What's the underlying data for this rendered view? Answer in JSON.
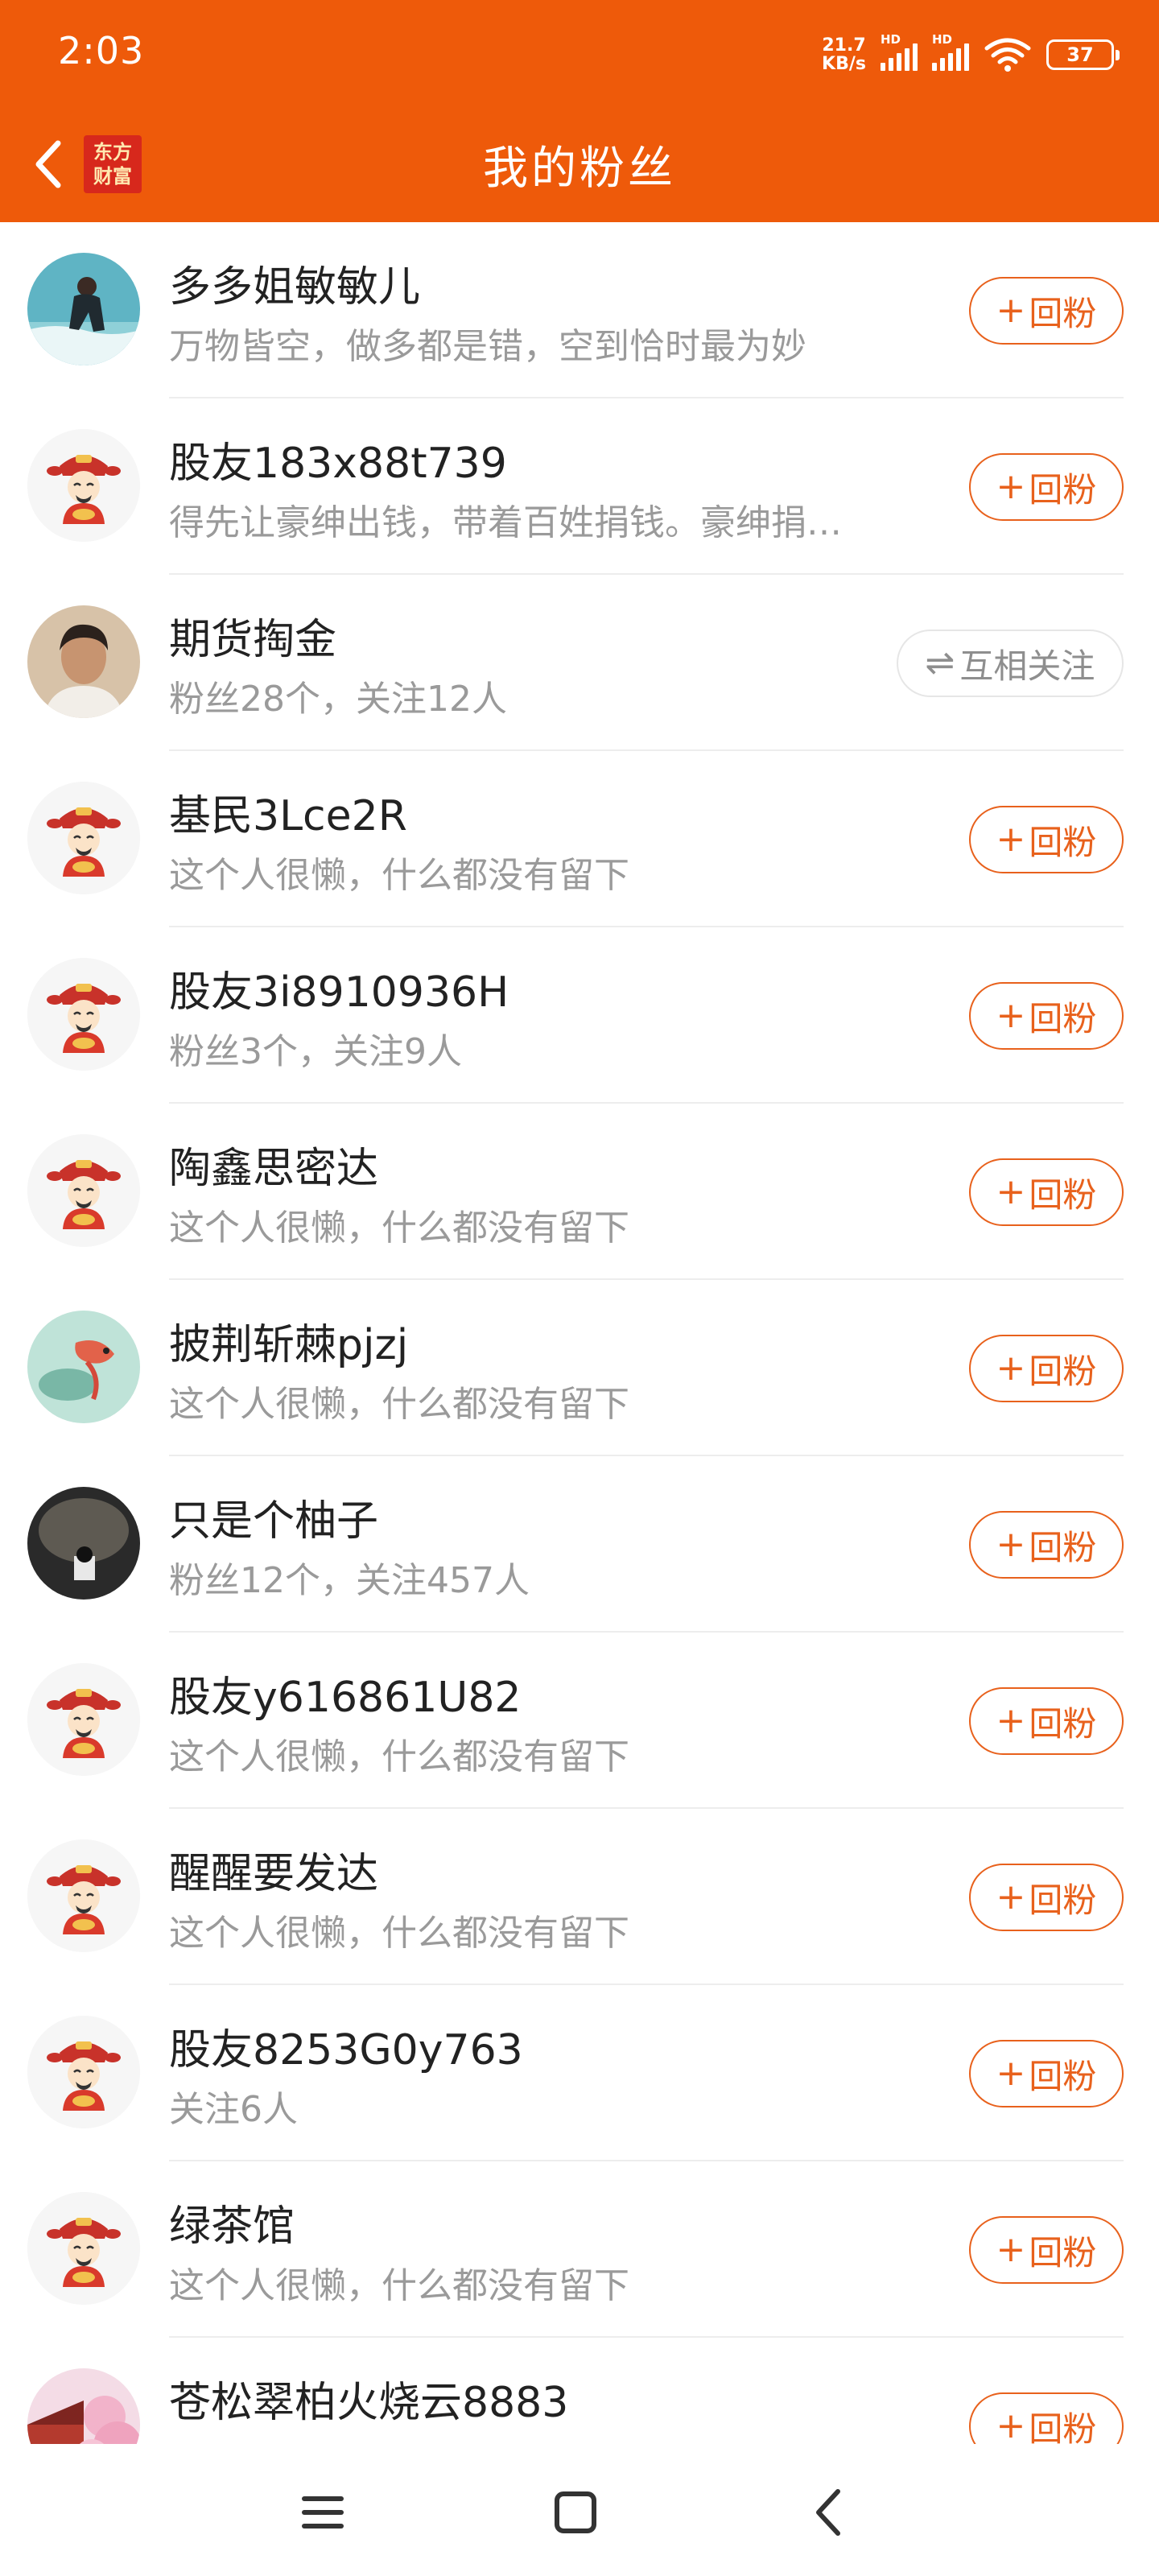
{
  "status_bar": {
    "time": "2:03",
    "net_speed_value": "21.7",
    "net_speed_unit": "KB/s",
    "hd_label": "HD",
    "battery": "37"
  },
  "nav": {
    "title": "我的粉丝",
    "logo_line1": "东方",
    "logo_line2": "财富"
  },
  "fans": [
    {
      "name": "多多姐敏敏儿",
      "desc": "万物皆空，做多都是错，空到恰时最为妙",
      "action": "回粉",
      "avatar": "photo-surfer"
    },
    {
      "name": "股友183x88t739",
      "desc": "得先让豪绅出钱，带着百姓捐钱。豪绅捐…",
      "action": "回粉",
      "avatar": "default-caishen"
    },
    {
      "name": "期货掏金",
      "desc": "粉丝28个，关注12人",
      "action": "互相关注",
      "avatar": "photo-portrait"
    },
    {
      "name": "基民3Lce2R",
      "desc": "这个人很懒，什么都没有留下",
      "action": "回粉",
      "avatar": "default-caishen"
    },
    {
      "name": "股友3i8910936H",
      "desc": "粉丝3个，关注9人",
      "action": "回粉",
      "avatar": "default-caishen"
    },
    {
      "name": "陶鑫思密达",
      "desc": "这个人很懒，什么都没有留下",
      "action": "回粉",
      "avatar": "default-caishen"
    },
    {
      "name": "披荆斩棘pjzj",
      "desc": "这个人很懒，什么都没有留下",
      "action": "回粉",
      "avatar": "photo-painting"
    },
    {
      "name": "只是个柚子",
      "desc": "粉丝12个，关注457人",
      "action": "回粉",
      "avatar": "photo-dark"
    },
    {
      "name": "股友y616861U82",
      "desc": "这个人很懒，什么都没有留下",
      "action": "回粉",
      "avatar": "default-caishen"
    },
    {
      "name": "醒醒要发达",
      "desc": "这个人很懒，什么都没有留下",
      "action": "回粉",
      "avatar": "default-caishen"
    },
    {
      "name": "股友8253G0y763",
      "desc": "关注6人",
      "action": "回粉",
      "avatar": "default-caishen"
    },
    {
      "name": "绿茶馆",
      "desc": "这个人很懒，什么都没有留下",
      "action": "回粉",
      "avatar": "default-caishen"
    },
    {
      "name": "苍松翠柏火烧云8883",
      "desc": "",
      "action": "回粉",
      "avatar": "photo-blossom"
    }
  ],
  "colors": {
    "brand_orange": "#EE5A0A",
    "button_orange": "#E8611C",
    "muted_gray": "#9A9A9A"
  },
  "icons": {
    "back": "chevron-left-icon",
    "follow_plus": "plus-icon",
    "mutual": "exchange-arrows-icon",
    "sys_menu": "menu-icon",
    "sys_home": "home-square-icon",
    "sys_back": "back-triangle-icon"
  }
}
